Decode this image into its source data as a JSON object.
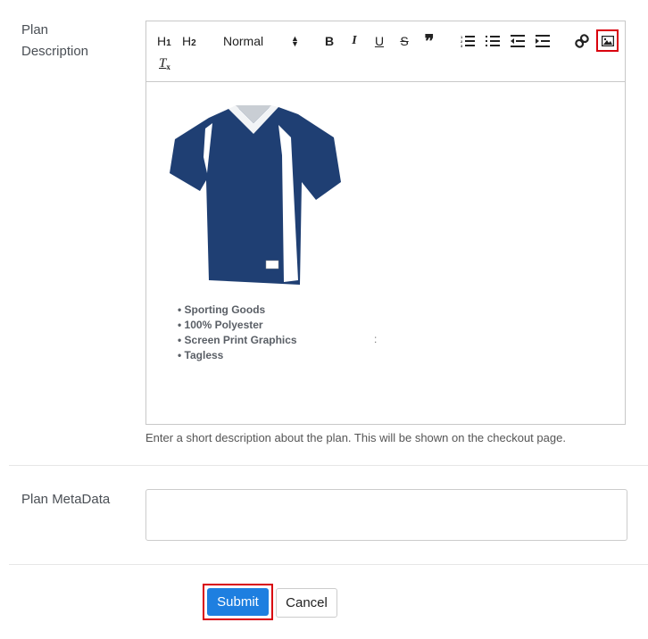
{
  "plan_description": {
    "label_line1": "Plan",
    "label_line2": "Description",
    "toolbar": {
      "h1": "H1",
      "h2": "H2",
      "format_select": "Normal",
      "bold": "B",
      "italic": "I",
      "underline": "U",
      "strike": "S",
      "quote": "”",
      "clear_format": "Tx"
    },
    "content": {
      "image_alt": "Navy and white v-neck sports jersey",
      "bullets": [
        "Sporting Goods",
        "100% Polyester",
        "Screen Print Graphics",
        "Tagless"
      ],
      "stray_char": ":"
    },
    "help_text": "Enter a short description about the plan. This will be shown on the checkout page."
  },
  "plan_metadata": {
    "label": "Plan MetaData",
    "value": ""
  },
  "actions": {
    "submit_label": "Submit",
    "cancel_label": "Cancel"
  },
  "colors": {
    "primary": "#1e7fe0",
    "highlight": "#d9000d",
    "jersey_navy": "#1f3f73"
  }
}
